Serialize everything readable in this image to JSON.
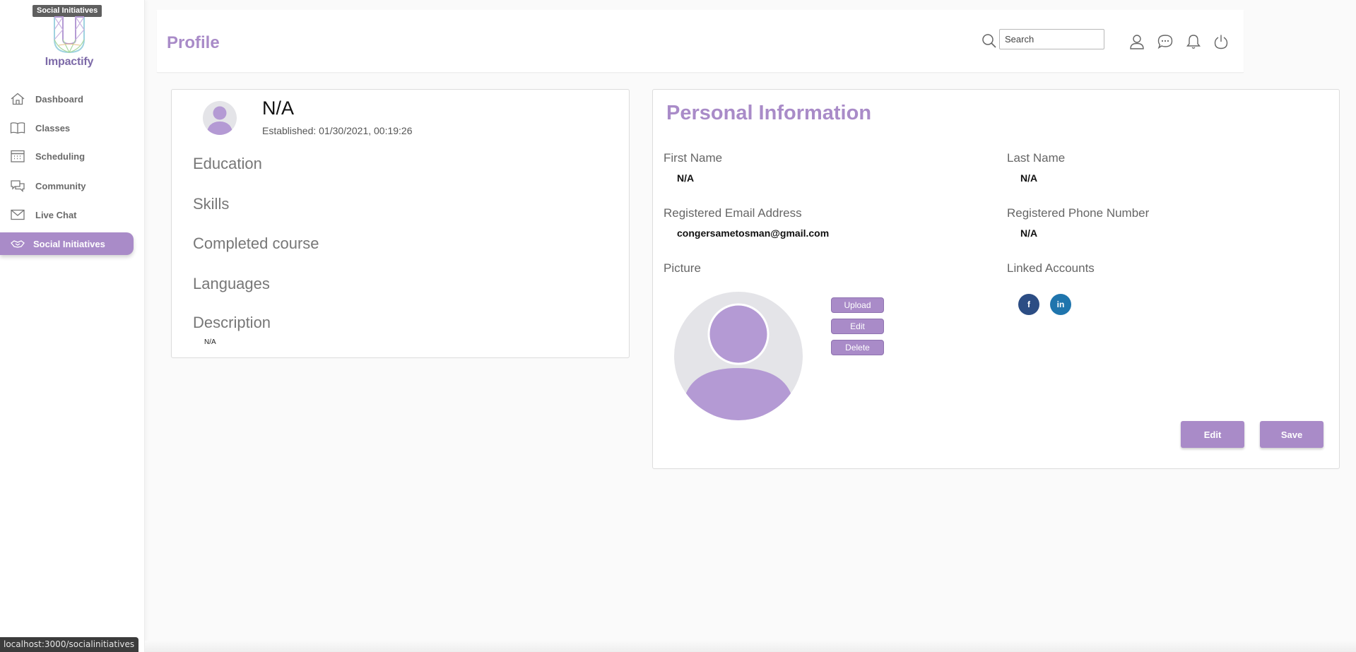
{
  "tooltip": "Social Initiatives",
  "brand": {
    "name": "Impactify"
  },
  "sidebar": {
    "items": [
      {
        "label": "Dashboard",
        "icon": "home-icon"
      },
      {
        "label": "Classes",
        "icon": "book-icon"
      },
      {
        "label": "Scheduling",
        "icon": "calendar-icon"
      },
      {
        "label": "Community",
        "icon": "chat-bubbles-icon"
      },
      {
        "label": "Live Chat",
        "icon": "mail-icon"
      },
      {
        "label": "Social Initiatives",
        "icon": "handshake-icon",
        "active": true
      }
    ]
  },
  "header": {
    "title": "Profile",
    "search_placeholder": "Search",
    "icons": [
      "search-icon",
      "user-icon",
      "chat-icon",
      "bell-icon",
      "power-icon"
    ]
  },
  "profile": {
    "name": "N/A",
    "established": "Established: 01/30/2021, 00:19:26",
    "sections": {
      "education": "Education",
      "skills": "Skills",
      "completed_course": "Completed course",
      "languages": "Languages",
      "description": "Description"
    },
    "description_value": "N/A"
  },
  "personal_info": {
    "title": "Personal Information",
    "first_name_label": "First Name",
    "first_name": "N/A",
    "last_name_label": "Last Name",
    "last_name": "N/A",
    "email_label": "Registered Email Address",
    "email": "congersametosman@gmail.com",
    "phone_label": "Registered Phone Number",
    "phone": "N/A",
    "picture_label": "Picture",
    "linked_accounts_label": "Linked Accounts",
    "picture_buttons": {
      "upload": "Upload",
      "edit": "Edit",
      "delete": "Delete"
    },
    "social": {
      "facebook": "f",
      "linkedin": "in"
    },
    "actions": {
      "edit": "Edit",
      "save": "Save"
    }
  },
  "status_bar": {
    "url": "localhost:3000/socialinitiatives"
  },
  "colors": {
    "accent": "#a98bc8",
    "facebook": "#2c4d84",
    "linkedin": "#1f75ad"
  }
}
